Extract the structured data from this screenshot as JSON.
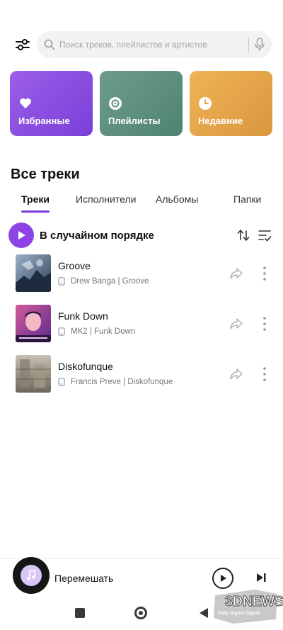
{
  "search": {
    "placeholder": "Поиск треков, плейлистов и артистов"
  },
  "quick_cards": [
    {
      "label": "Избранные",
      "icon": "heart-icon",
      "color": "#8a4fe0"
    },
    {
      "label": "Плейлисты",
      "icon": "playlist-disc-icon",
      "color": "#5f8f7f"
    },
    {
      "label": "Недавние",
      "icon": "clock-icon",
      "color": "#e6a64a"
    }
  ],
  "section_title": "Все треки",
  "tabs": [
    "Треки",
    "Исполнители",
    "Альбомы",
    "Папки"
  ],
  "active_tab": "Треки",
  "shuffle_label": "В случайном порядке",
  "tracks": [
    {
      "title": "Groove",
      "subtitle": "Drew Banga | Groove"
    },
    {
      "title": "Funk Down",
      "subtitle": "MK2 | Funk Down"
    },
    {
      "title": "Diskofunque",
      "subtitle": "Francis Preve | Diskofunque"
    }
  ],
  "mini_player": {
    "label": "Перемешать"
  },
  "watermark": {
    "line1": "3DNEWS",
    "line2": "Daily Digital Digest"
  },
  "colors": {
    "accent": "#8e44e4",
    "tab_underline": "#7a3bdc"
  }
}
